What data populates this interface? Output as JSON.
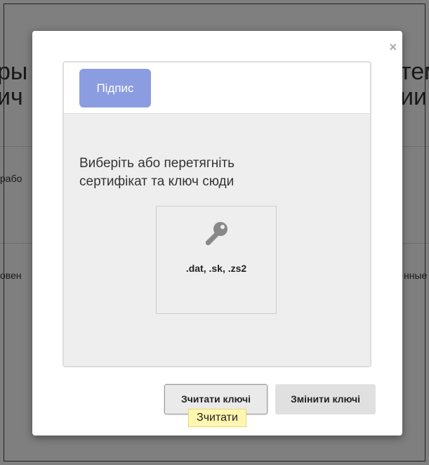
{
  "background": {
    "title_left_1": "ры",
    "title_left_2": "ич",
    "title_right_1": "тем",
    "title_right_2": "ии",
    "text_left_1": "рабо",
    "text_left_2": "овен",
    "text_right": "нные"
  },
  "modal": {
    "close_label": "×",
    "tab_sign_label": "Підпис",
    "drop_line_1": "Виберіть або перетягніть",
    "drop_line_2": "сертифікат та ключ сюди",
    "extensions": ".dat, .sk, .zs2",
    "read_keys_label": "Зчитати ключі",
    "change_keys_label": "Змінити ключі",
    "tooltip": "Зчитати"
  }
}
